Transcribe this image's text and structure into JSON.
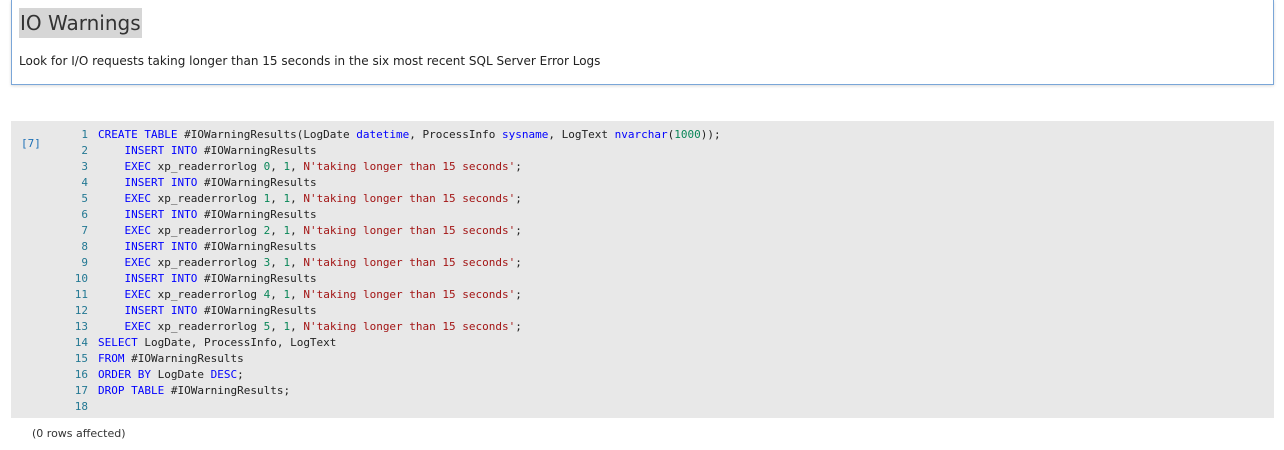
{
  "toolbar": {
    "more_icon": "more-options-icon",
    "more_label": "···"
  },
  "markdown_cell": {
    "title": "IO Warnings",
    "description": "Look for I/O requests taking longer than 15 seconds in the six most recent SQL Server Error Logs"
  },
  "code_cell": {
    "execution_count": "[7]",
    "lines": [
      {
        "n": "1",
        "tokens": [
          {
            "t": "CREATE TABLE",
            "c": "kw"
          },
          {
            "t": " #IOWarningResults(LogDate ",
            "c": ""
          },
          {
            "t": "datetime",
            "c": "ty"
          },
          {
            "t": ", ProcessInfo ",
            "c": ""
          },
          {
            "t": "sysname",
            "c": "ty"
          },
          {
            "t": ", LogText ",
            "c": ""
          },
          {
            "t": "nvarchar",
            "c": "ty"
          },
          {
            "t": "(",
            "c": ""
          },
          {
            "t": "1000",
            "c": "num"
          },
          {
            "t": "));",
            "c": ""
          }
        ]
      },
      {
        "n": "2",
        "tokens": [
          {
            "t": "    ",
            "c": ""
          },
          {
            "t": "INSERT INTO",
            "c": "kw"
          },
          {
            "t": " #IOWarningResults",
            "c": ""
          }
        ]
      },
      {
        "n": "3",
        "tokens": [
          {
            "t": "    ",
            "c": ""
          },
          {
            "t": "EXEC",
            "c": "kw"
          },
          {
            "t": " xp_readerrorlog ",
            "c": ""
          },
          {
            "t": "0",
            "c": "num"
          },
          {
            "t": ", ",
            "c": ""
          },
          {
            "t": "1",
            "c": "num"
          },
          {
            "t": ", ",
            "c": ""
          },
          {
            "t": "N'taking longer than 15 seconds'",
            "c": "str"
          },
          {
            "t": ";",
            "c": ""
          }
        ]
      },
      {
        "n": "4",
        "tokens": [
          {
            "t": "    ",
            "c": ""
          },
          {
            "t": "INSERT INTO",
            "c": "kw"
          },
          {
            "t": " #IOWarningResults",
            "c": ""
          }
        ]
      },
      {
        "n": "5",
        "tokens": [
          {
            "t": "    ",
            "c": ""
          },
          {
            "t": "EXEC",
            "c": "kw"
          },
          {
            "t": " xp_readerrorlog ",
            "c": ""
          },
          {
            "t": "1",
            "c": "num"
          },
          {
            "t": ", ",
            "c": ""
          },
          {
            "t": "1",
            "c": "num"
          },
          {
            "t": ", ",
            "c": ""
          },
          {
            "t": "N'taking longer than 15 seconds'",
            "c": "str"
          },
          {
            "t": ";",
            "c": ""
          }
        ]
      },
      {
        "n": "6",
        "tokens": [
          {
            "t": "    ",
            "c": ""
          },
          {
            "t": "INSERT INTO",
            "c": "kw"
          },
          {
            "t": " #IOWarningResults",
            "c": ""
          }
        ]
      },
      {
        "n": "7",
        "tokens": [
          {
            "t": "    ",
            "c": ""
          },
          {
            "t": "EXEC",
            "c": "kw"
          },
          {
            "t": " xp_readerrorlog ",
            "c": ""
          },
          {
            "t": "2",
            "c": "num"
          },
          {
            "t": ", ",
            "c": ""
          },
          {
            "t": "1",
            "c": "num"
          },
          {
            "t": ", ",
            "c": ""
          },
          {
            "t": "N'taking longer than 15 seconds'",
            "c": "str"
          },
          {
            "t": ";",
            "c": ""
          }
        ]
      },
      {
        "n": "8",
        "tokens": [
          {
            "t": "    ",
            "c": ""
          },
          {
            "t": "INSERT INTO",
            "c": "kw"
          },
          {
            "t": " #IOWarningResults",
            "c": ""
          }
        ]
      },
      {
        "n": "9",
        "tokens": [
          {
            "t": "    ",
            "c": ""
          },
          {
            "t": "EXEC",
            "c": "kw"
          },
          {
            "t": " xp_readerrorlog ",
            "c": ""
          },
          {
            "t": "3",
            "c": "num"
          },
          {
            "t": ", ",
            "c": ""
          },
          {
            "t": "1",
            "c": "num"
          },
          {
            "t": ", ",
            "c": ""
          },
          {
            "t": "N'taking longer than 15 seconds'",
            "c": "str"
          },
          {
            "t": ";",
            "c": ""
          }
        ]
      },
      {
        "n": "10",
        "tokens": [
          {
            "t": "    ",
            "c": ""
          },
          {
            "t": "INSERT INTO",
            "c": "kw"
          },
          {
            "t": " #IOWarningResults",
            "c": ""
          }
        ]
      },
      {
        "n": "11",
        "tokens": [
          {
            "t": "    ",
            "c": ""
          },
          {
            "t": "EXEC",
            "c": "kw"
          },
          {
            "t": " xp_readerrorlog ",
            "c": ""
          },
          {
            "t": "4",
            "c": "num"
          },
          {
            "t": ", ",
            "c": ""
          },
          {
            "t": "1",
            "c": "num"
          },
          {
            "t": ", ",
            "c": ""
          },
          {
            "t": "N'taking longer than 15 seconds'",
            "c": "str"
          },
          {
            "t": ";",
            "c": ""
          }
        ]
      },
      {
        "n": "12",
        "tokens": [
          {
            "t": "    ",
            "c": ""
          },
          {
            "t": "INSERT INTO",
            "c": "kw"
          },
          {
            "t": " #IOWarningResults",
            "c": ""
          }
        ]
      },
      {
        "n": "13",
        "tokens": [
          {
            "t": "    ",
            "c": ""
          },
          {
            "t": "EXEC",
            "c": "kw"
          },
          {
            "t": " xp_readerrorlog ",
            "c": ""
          },
          {
            "t": "5",
            "c": "num"
          },
          {
            "t": ", ",
            "c": ""
          },
          {
            "t": "1",
            "c": "num"
          },
          {
            "t": ", ",
            "c": ""
          },
          {
            "t": "N'taking longer than 15 seconds'",
            "c": "str"
          },
          {
            "t": ";",
            "c": ""
          }
        ]
      },
      {
        "n": "14",
        "tokens": [
          {
            "t": "SELECT",
            "c": "kw"
          },
          {
            "t": " LogDate, ProcessInfo, LogText",
            "c": ""
          }
        ]
      },
      {
        "n": "15",
        "tokens": [
          {
            "t": "FROM",
            "c": "kw"
          },
          {
            "t": " #IOWarningResults",
            "c": ""
          }
        ]
      },
      {
        "n": "16",
        "tokens": [
          {
            "t": "ORDER BY",
            "c": "kw"
          },
          {
            "t": " LogDate ",
            "c": ""
          },
          {
            "t": "DESC",
            "c": "kw"
          },
          {
            "t": ";",
            "c": ""
          }
        ]
      },
      {
        "n": "17",
        "tokens": [
          {
            "t": "DROP TABLE",
            "c": "kw"
          },
          {
            "t": " #IOWarningResults;",
            "c": ""
          }
        ]
      },
      {
        "n": "18",
        "tokens": []
      }
    ]
  },
  "output": {
    "text": "(0 rows affected)"
  }
}
